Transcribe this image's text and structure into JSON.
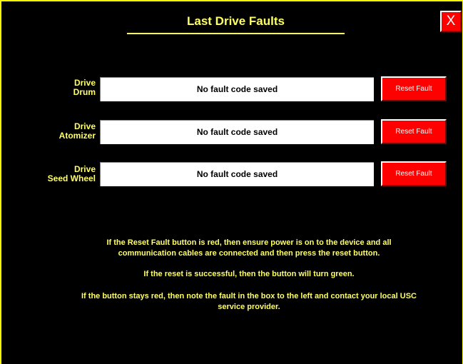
{
  "header": {
    "title": "Last Drive Faults",
    "close_label": "X"
  },
  "faults": [
    {
      "label_line1": "Drive",
      "label_line2": "Drum",
      "value": "No fault code saved",
      "reset_label": "Reset Fault",
      "reset_status": "red"
    },
    {
      "label_line1": "Drive",
      "label_line2": "Atomizer",
      "value": "No fault code saved",
      "reset_label": "Reset Fault",
      "reset_status": "red"
    },
    {
      "label_line1": "Drive",
      "label_line2": "Seed Wheel",
      "value": "No fault code saved",
      "reset_label": "Reset Fault",
      "reset_status": "red"
    }
  ],
  "instructions": {
    "p1_line1": "If the Reset Fault button is red, then ensure power is on to the device and all",
    "p1_line2": "communication cables are connected and then press the reset button.",
    "p2_line1": "If the reset is successful, then the button will turn green.",
    "p3_line1": "If the button stays red, then note the fault  in the box to the left and contact your local USC",
    "p3_line2": "service provider."
  },
  "colors": {
    "background": "#000000",
    "text_accent": "#ffff66",
    "button_red": "#ff0000",
    "field_white": "#ffffff"
  }
}
